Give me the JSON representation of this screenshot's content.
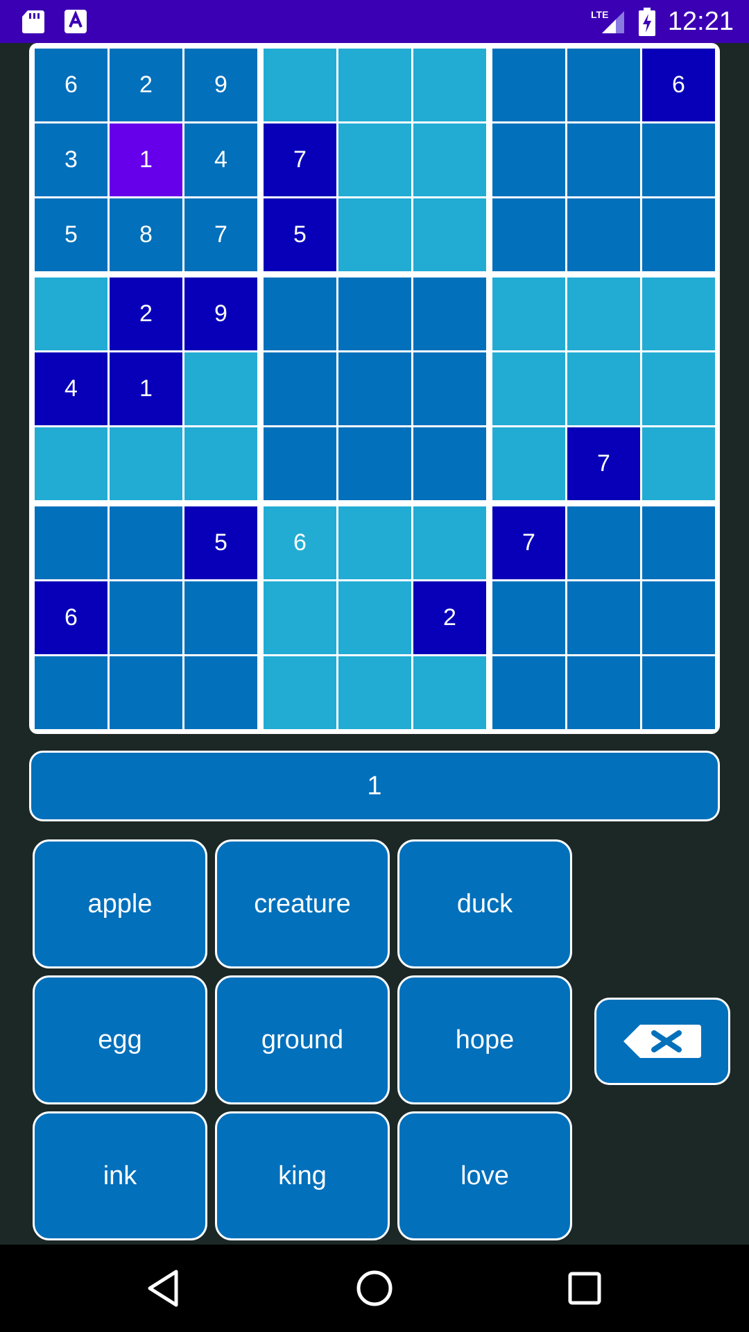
{
  "status_bar": {
    "time": "12:21",
    "network": "LTE",
    "icons": [
      "sd-card-icon",
      "font-download-icon",
      "lte-signal-icon",
      "battery-charging-icon"
    ]
  },
  "board": {
    "rows": [
      [
        {
          "v": "6",
          "t": "dark"
        },
        {
          "v": "2",
          "t": "dark"
        },
        {
          "v": "9",
          "t": "dark"
        },
        {
          "v": "",
          "t": "light"
        },
        {
          "v": "",
          "t": "light"
        },
        {
          "v": "",
          "t": "light"
        },
        {
          "v": "",
          "t": "dark"
        },
        {
          "v": "",
          "t": "dark"
        },
        {
          "v": "6",
          "t": "given"
        }
      ],
      [
        {
          "v": "3",
          "t": "dark"
        },
        {
          "v": "1",
          "t": "selected"
        },
        {
          "v": "4",
          "t": "dark"
        },
        {
          "v": "7",
          "t": "given"
        },
        {
          "v": "",
          "t": "light"
        },
        {
          "v": "",
          "t": "light"
        },
        {
          "v": "",
          "t": "dark"
        },
        {
          "v": "",
          "t": "dark"
        },
        {
          "v": "",
          "t": "dark"
        }
      ],
      [
        {
          "v": "5",
          "t": "dark"
        },
        {
          "v": "8",
          "t": "dark"
        },
        {
          "v": "7",
          "t": "dark"
        },
        {
          "v": "5",
          "t": "given"
        },
        {
          "v": "",
          "t": "light"
        },
        {
          "v": "",
          "t": "light"
        },
        {
          "v": "",
          "t": "dark"
        },
        {
          "v": "",
          "t": "dark"
        },
        {
          "v": "",
          "t": "dark"
        }
      ],
      [
        {
          "v": "",
          "t": "light"
        },
        {
          "v": "2",
          "t": "given"
        },
        {
          "v": "9",
          "t": "given"
        },
        {
          "v": "",
          "t": "dark"
        },
        {
          "v": "",
          "t": "dark"
        },
        {
          "v": "",
          "t": "dark"
        },
        {
          "v": "",
          "t": "light"
        },
        {
          "v": "",
          "t": "light"
        },
        {
          "v": "",
          "t": "light"
        }
      ],
      [
        {
          "v": "4",
          "t": "given"
        },
        {
          "v": "1",
          "t": "given"
        },
        {
          "v": "",
          "t": "light"
        },
        {
          "v": "",
          "t": "dark"
        },
        {
          "v": "",
          "t": "dark"
        },
        {
          "v": "",
          "t": "dark"
        },
        {
          "v": "",
          "t": "light"
        },
        {
          "v": "",
          "t": "light"
        },
        {
          "v": "",
          "t": "light"
        }
      ],
      [
        {
          "v": "",
          "t": "light"
        },
        {
          "v": "",
          "t": "light"
        },
        {
          "v": "",
          "t": "light"
        },
        {
          "v": "",
          "t": "dark"
        },
        {
          "v": "",
          "t": "dark"
        },
        {
          "v": "",
          "t": "dark"
        },
        {
          "v": "",
          "t": "light"
        },
        {
          "v": "7",
          "t": "given"
        },
        {
          "v": "",
          "t": "light"
        }
      ],
      [
        {
          "v": "",
          "t": "dark"
        },
        {
          "v": "",
          "t": "dark"
        },
        {
          "v": "5",
          "t": "given"
        },
        {
          "v": "6",
          "t": "light"
        },
        {
          "v": "",
          "t": "light"
        },
        {
          "v": "",
          "t": "light"
        },
        {
          "v": "7",
          "t": "given"
        },
        {
          "v": "",
          "t": "dark"
        },
        {
          "v": "",
          "t": "dark"
        }
      ],
      [
        {
          "v": "6",
          "t": "given"
        },
        {
          "v": "",
          "t": "dark"
        },
        {
          "v": "",
          "t": "dark"
        },
        {
          "v": "",
          "t": "light"
        },
        {
          "v": "",
          "t": "light"
        },
        {
          "v": "2",
          "t": "given"
        },
        {
          "v": "",
          "t": "dark"
        },
        {
          "v": "",
          "t": "dark"
        },
        {
          "v": "",
          "t": "dark"
        }
      ],
      [
        {
          "v": "",
          "t": "dark"
        },
        {
          "v": "",
          "t": "dark"
        },
        {
          "v": "",
          "t": "dark"
        },
        {
          "v": "",
          "t": "light"
        },
        {
          "v": "",
          "t": "light"
        },
        {
          "v": "",
          "t": "light"
        },
        {
          "v": "",
          "t": "dark"
        },
        {
          "v": "",
          "t": "dark"
        },
        {
          "v": "",
          "t": "dark"
        }
      ]
    ]
  },
  "selection": {
    "value": "1"
  },
  "word_buttons": [
    [
      "apple",
      "creature",
      "duck"
    ],
    [
      "egg",
      "ground",
      "hope"
    ],
    [
      "ink",
      "king",
      "love"
    ]
  ],
  "backspace": {
    "icon": "backspace-icon"
  },
  "nav_bar": {
    "icons": [
      "back-icon",
      "home-icon",
      "recents-icon"
    ]
  },
  "colors": {
    "status_bar": "#3c00b4",
    "background": "#1c2826",
    "cell_dark": "#0270bb",
    "cell_light": "#22acd4",
    "cell_given": "#0800b8",
    "cell_selected": "#6600ea",
    "button": "#0270bb"
  }
}
